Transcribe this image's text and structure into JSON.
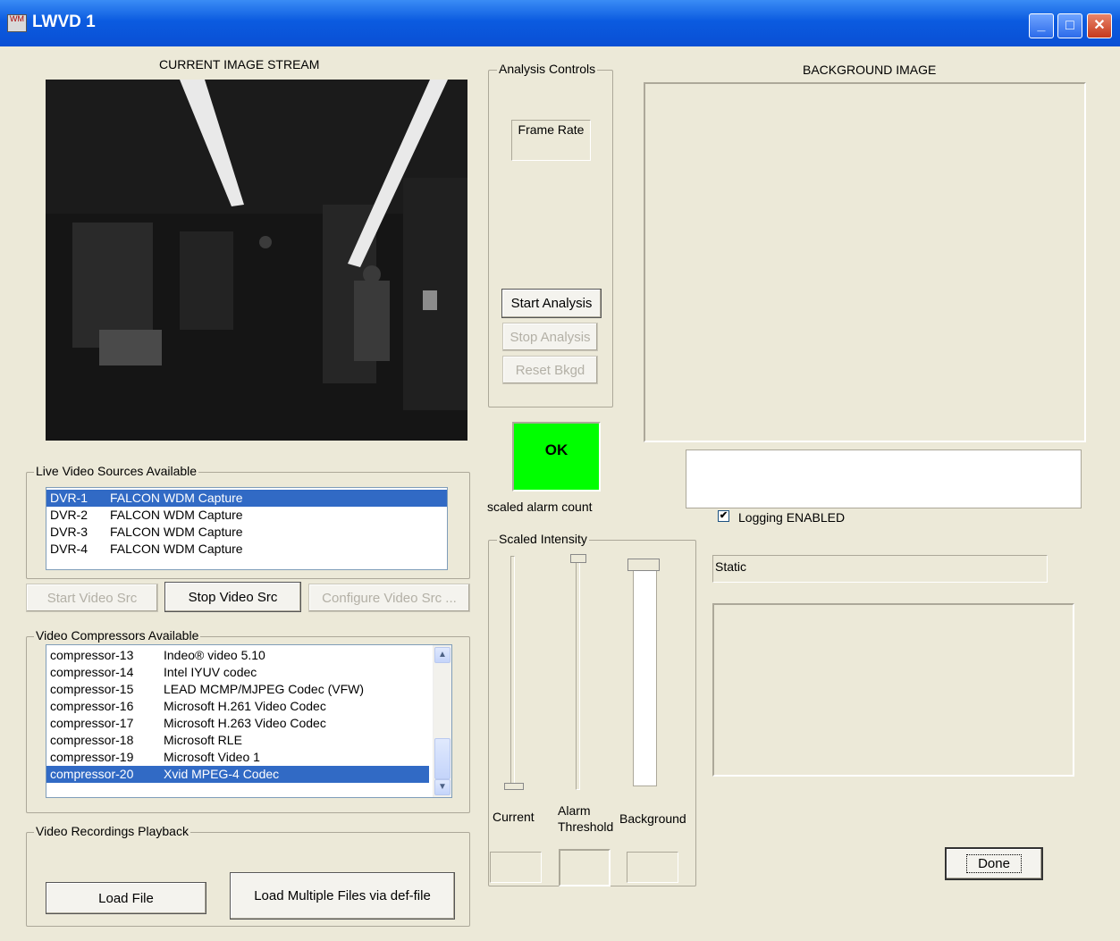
{
  "window": {
    "title": "LWVD 1",
    "app_icon": "WM",
    "controls": {
      "minimize": "_",
      "maximize": "□",
      "close": "✕"
    }
  },
  "current_image": {
    "title": "CURRENT IMAGE STREAM"
  },
  "live_sources": {
    "title": "Live Video Sources Available",
    "items": [
      {
        "id": "DVR-1",
        "name": "FALCON WDM Capture",
        "selected": true
      },
      {
        "id": "DVR-2",
        "name": "FALCON WDM Capture",
        "selected": false
      },
      {
        "id": "DVR-3",
        "name": "FALCON WDM Capture",
        "selected": false
      },
      {
        "id": "DVR-4",
        "name": "FALCON WDM Capture",
        "selected": false
      }
    ],
    "start_label": "Start Video Src",
    "stop_label": "Stop Video Src",
    "configure_label": "Configure Video Src ..."
  },
  "compressors": {
    "title": "Video Compressors Available",
    "items": [
      {
        "id": "compressor-13",
        "name": "Indeo® video 5.10",
        "selected": false
      },
      {
        "id": "compressor-14",
        "name": "Intel IYUV codec",
        "selected": false
      },
      {
        "id": "compressor-15",
        "name": "LEAD MCMP/MJPEG Codec (VFW)",
        "selected": false
      },
      {
        "id": "compressor-16",
        "name": "Microsoft H.261 Video Codec",
        "selected": false
      },
      {
        "id": "compressor-17",
        "name": "Microsoft H.263 Video Codec",
        "selected": false
      },
      {
        "id": "compressor-18",
        "name": "Microsoft RLE",
        "selected": false
      },
      {
        "id": "compressor-19",
        "name": "Microsoft Video 1",
        "selected": false
      },
      {
        "id": "compressor-20",
        "name": "Xvid MPEG-4 Codec",
        "selected": true
      }
    ]
  },
  "playback": {
    "title": "Video Recordings Playback",
    "load_file_label": "Load File",
    "load_multi_label": "Load Multiple Files via def-file"
  },
  "analysis": {
    "title": "Analysis Controls",
    "frame_rate_label": "Frame Rate",
    "start_label": "Start Analysis",
    "stop_label": "Stop Analysis",
    "reset_label": "Reset Bkgd"
  },
  "alarm": {
    "status": "OK",
    "status_color": "#00FF00",
    "caption": "scaled alarm count"
  },
  "intensity": {
    "title": "Scaled Intensity",
    "current_label": "Current",
    "alarm_label_line1": "Alarm",
    "alarm_label_line2": "Threshold",
    "background_label": "Background",
    "current_level": 0.0,
    "threshold_level": 1.0,
    "background_level": 1.0
  },
  "background_image": {
    "title": "BACKGROUND IMAGE"
  },
  "logging": {
    "label": "Logging ENABLED",
    "checked": true
  },
  "static_text": "Static",
  "done_label": "Done",
  "colors": {
    "window_bg": "#ECE9D8",
    "selection": "#316AC5",
    "titlebar": "#0A4FD4"
  }
}
